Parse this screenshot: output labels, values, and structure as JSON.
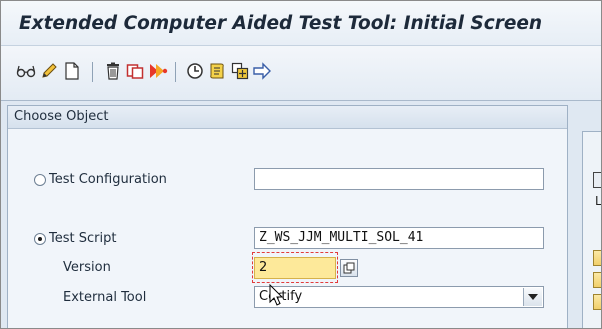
{
  "window": {
    "title": "Extended Computer Aided Test Tool: Initial Screen"
  },
  "toolbar": {
    "icons": [
      "glasses-icon",
      "pencil-icon",
      "new-document-icon",
      "delete-icon",
      "copy-icon",
      "execute-icon",
      "clock-icon",
      "list-icon",
      "transport-icon",
      "where-used-icon"
    ]
  },
  "panel": {
    "header": "Choose Object",
    "test_configuration": {
      "label": "Test Configuration",
      "value": "",
      "selected": false
    },
    "test_script": {
      "label": "Test Script",
      "value": "Z_WS_JJM_MULTI_SOL_41",
      "selected": true
    },
    "version": {
      "label": "Version",
      "value": "2"
    },
    "external_tool": {
      "label": "External Tool",
      "value": "Certify"
    }
  },
  "right_pane": {
    "label": "L"
  },
  "colors": {
    "highlight_field": "#fde99a",
    "marker": "#e23b3b"
  }
}
